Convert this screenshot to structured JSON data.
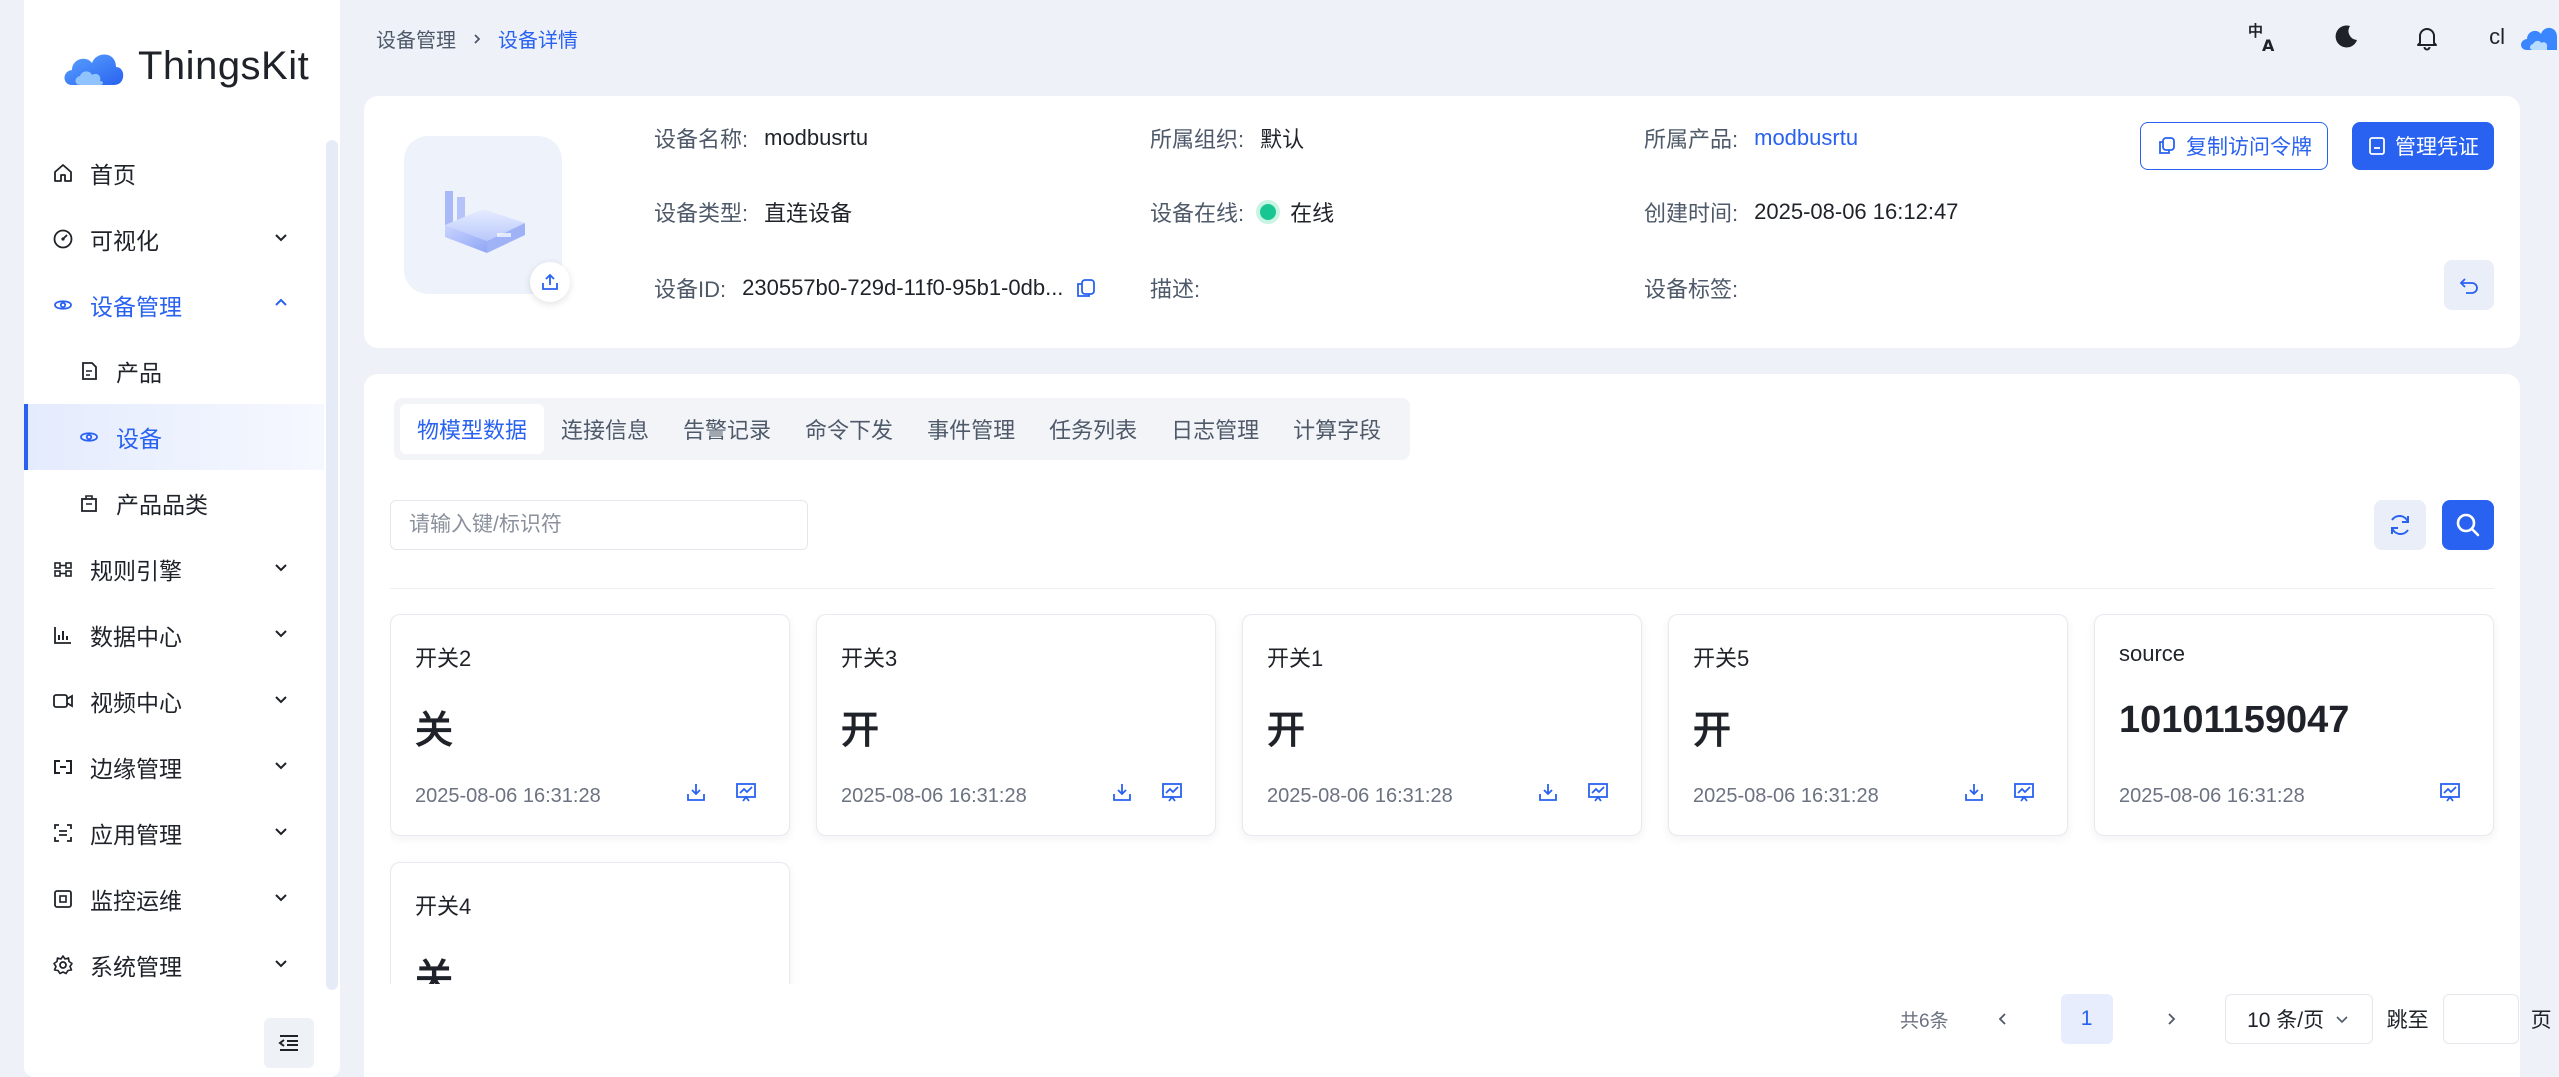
{
  "app": {
    "name": "ThingsKit"
  },
  "colors": {
    "accent": "#2962f0",
    "online": "#17c690",
    "bg": "#eef1f8"
  },
  "sidebar": {
    "items": [
      {
        "label": "首页",
        "icon": "home-icon"
      },
      {
        "label": "可视化",
        "icon": "dashboard-icon"
      },
      {
        "label": "设备管理",
        "icon": "device-icon"
      },
      {
        "label": "产品",
        "icon": "product-icon"
      },
      {
        "label": "设备",
        "icon": "device-icon"
      },
      {
        "label": "产品品类",
        "icon": "category-icon"
      },
      {
        "label": "规则引擎",
        "icon": "rule-engine-icon"
      },
      {
        "label": "数据中心",
        "icon": "chart-icon"
      },
      {
        "label": "视频中心",
        "icon": "video-icon"
      },
      {
        "label": "边缘管理",
        "icon": "edge-icon"
      },
      {
        "label": "应用管理",
        "icon": "app-icon"
      },
      {
        "label": "监控运维",
        "icon": "monitor-icon"
      },
      {
        "label": "系统管理",
        "icon": "gear-icon"
      }
    ]
  },
  "header": {
    "breadcrumb": [
      "设备管理",
      "设备详情"
    ],
    "user": "cl",
    "icons": [
      "translate-icon",
      "dark-mode-icon",
      "bell-icon",
      "avatar-icon"
    ]
  },
  "device": {
    "name_label": "设备名称:",
    "name": "modbusrtu",
    "org_label": "所属组织:",
    "org": "默认",
    "product_label": "所属产品:",
    "product": "modbusrtu",
    "type_label": "设备类型:",
    "type": "直连设备",
    "online_label": "设备在线:",
    "online": "在线",
    "created_label": "创建时间:",
    "created": "2025-08-06 16:12:47",
    "id_label": "设备ID:",
    "id": "230557b0-729d-11f0-95b1-0db...",
    "desc_label": "描述:",
    "tags_label": "设备标签:",
    "copy_token_label": "复制访问令牌",
    "manage_cred_label": "管理凭证"
  },
  "tabs": [
    "物模型数据",
    "连接信息",
    "告警记录",
    "命令下发",
    "事件管理",
    "任务列表",
    "日志管理",
    "计算字段"
  ],
  "search": {
    "placeholder": "请输入键/标识符"
  },
  "telemetry": [
    {
      "name": "开关2",
      "value": "关",
      "time": "2025-08-06 16:31:28",
      "download": true
    },
    {
      "name": "开关3",
      "value": "开",
      "time": "2025-08-06 16:31:28",
      "download": true
    },
    {
      "name": "开关1",
      "value": "开",
      "time": "2025-08-06 16:31:28",
      "download": true
    },
    {
      "name": "开关5",
      "value": "开",
      "time": "2025-08-06 16:31:28",
      "download": true
    },
    {
      "name": "source",
      "value": "10101159047",
      "time": "2025-08-06 16:31:28",
      "download": false
    },
    {
      "name": "开关4",
      "value": "关",
      "time": "",
      "download": false
    }
  ],
  "pagination": {
    "total": "共6条",
    "current": "1",
    "page_size": "10 条/页",
    "jump_label": "跳至",
    "unit": "页"
  }
}
